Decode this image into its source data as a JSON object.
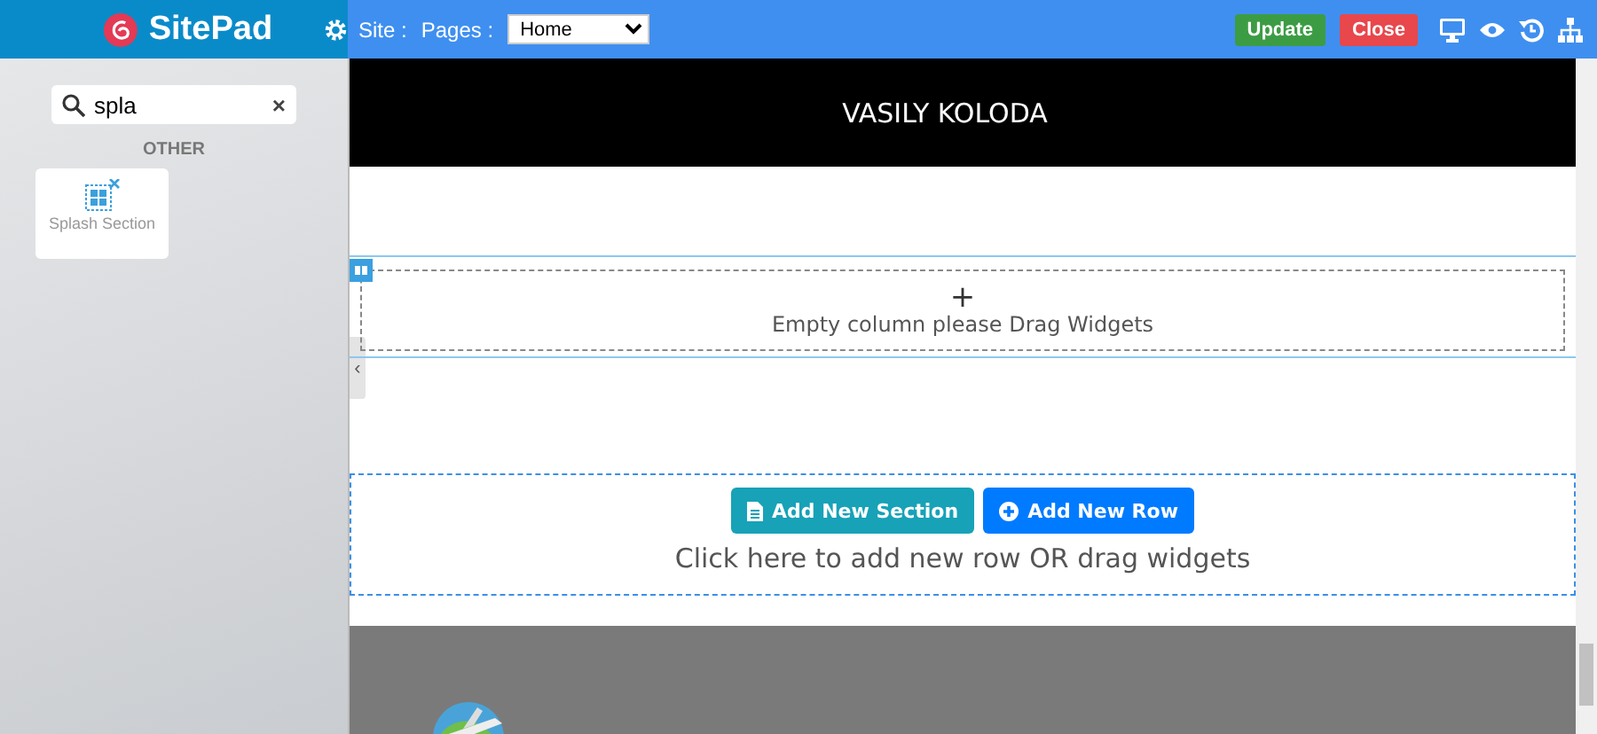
{
  "brand": {
    "name": "SitePad"
  },
  "topbar": {
    "site_label": "Site :",
    "pages_label": "Pages :",
    "page_select": "Home",
    "buttons": [
      {
        "label": "Update",
        "kind": "update"
      },
      {
        "label": "Close",
        "kind": "close"
      }
    ]
  },
  "sidebar": {
    "search": {
      "value": "spla",
      "clear": "×"
    },
    "group": "OTHER",
    "widgets": [
      {
        "label": "Splash Section"
      }
    ],
    "collapse": "‹"
  },
  "canvas": {
    "header_title": "VASILY KOLODA",
    "empty_column": {
      "icon": "+",
      "text": "Empty column please Drag Widgets"
    },
    "add_area": {
      "buttons": [
        {
          "label": "Add New Section",
          "kind": "section"
        },
        {
          "label": "Add New Row",
          "kind": "row"
        }
      ],
      "hint": "Click here to add new row OR drag widgets"
    }
  }
}
